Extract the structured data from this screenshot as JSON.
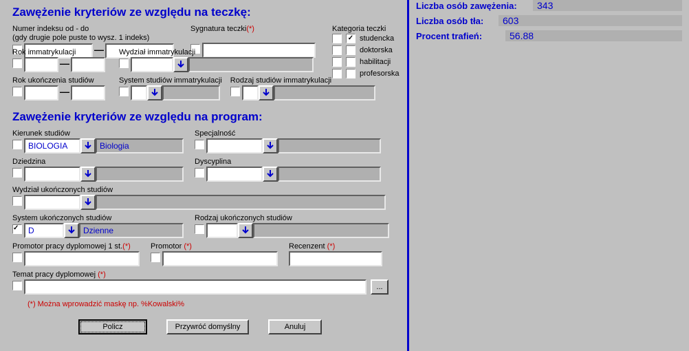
{
  "section1": {
    "title": "Zawężenie kryteriów ze względu na teczkę:",
    "index_label": "Numer indeksu od - do",
    "index_hint": "(gdy drugie pole puste to wysz. 1 indeks)",
    "sygnatura_label": "Sygnatura teczki",
    "kategoria_label": "Kategoria teczki",
    "rok_imm_label": "Rok immatrykulacji",
    "wydz_imm_label": "Wydział immatrykulacji",
    "rok_uk_label": "Rok ukończenia studiów",
    "system_imm_label": "System studiów immatrykulacji",
    "rodzaj_imm_label": "Rodzaj studiów immatrykulacji",
    "categories": [
      {
        "label": "studencka",
        "checked": true
      },
      {
        "label": "doktorska",
        "checked": false
      },
      {
        "label": "habilitacji",
        "checked": false
      },
      {
        "label": "profesorska",
        "checked": false
      }
    ]
  },
  "section2": {
    "title": "Zawężenie kryteriów ze względu na program:",
    "kierunek_label": "Kierunek studiów",
    "kierunek_code": "BIOLOGIA",
    "kierunek_name": "Biologia",
    "specjalnosc_label": "Specjalność",
    "dziedzina_label": "Dziedzina",
    "dyscyplina_label": "Dyscyplina",
    "wydz_uk_label": "Wydział ukończonych studiów",
    "system_uk_label": "System ukończonych studiów",
    "system_uk_code": "D",
    "system_uk_name": "Dzienne",
    "rodzaj_uk_label": "Rodzaj ukończonych studiów",
    "prom1_label": "Promotor pracy dyplomowej 1 st.",
    "prom_label": "Promotor",
    "rec_label": "Recenzent",
    "temat_label": "Temat pracy dyplomowej",
    "asterisk": "(*)",
    "note": "(*) Można wprowadzić maskę np. %Kowalski%"
  },
  "buttons": {
    "policz": "Policz",
    "przywroc": "Przywróć domyślny",
    "anuluj": "Anuluj"
  },
  "stats": {
    "zaw_label": "Liczba osób zawężenia:",
    "zaw_val": "343",
    "tla_label": "Liczba osób tła:",
    "tla_val": "603",
    "traf_label": "Procent trafień:",
    "traf_val": "56.88"
  }
}
